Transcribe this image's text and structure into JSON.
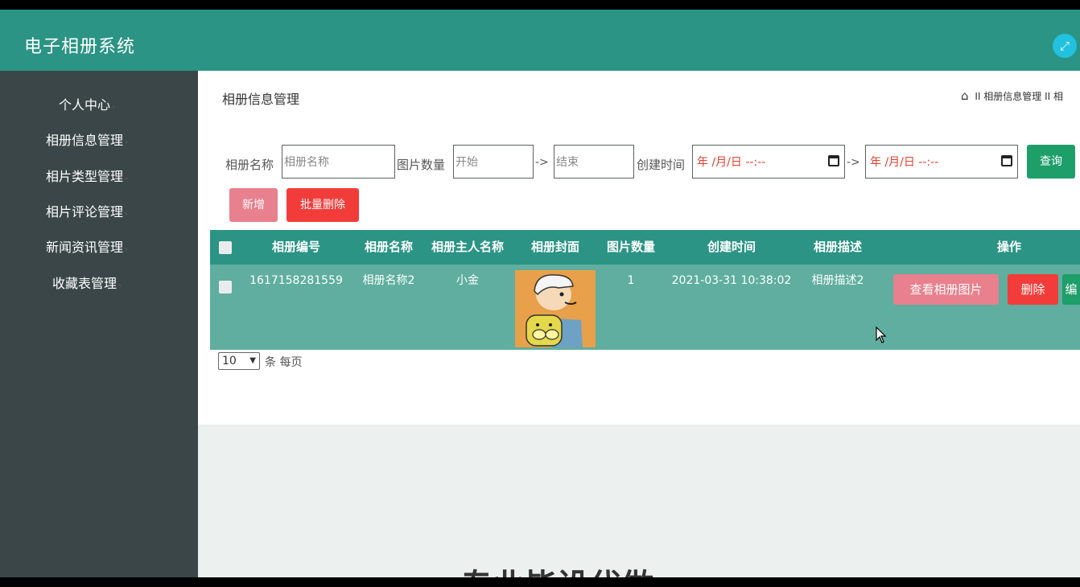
{
  "app": {
    "title": "电子相册系统",
    "fullscreen_icon": "expand-icon"
  },
  "sidebar": {
    "items": [
      {
        "label": "个人中心"
      },
      {
        "label": "相册信息管理"
      },
      {
        "label": "相片类型管理"
      },
      {
        "label": "相片评论管理"
      },
      {
        "label": "新闻资讯管理"
      },
      {
        "label": "收藏表管理"
      }
    ]
  },
  "page": {
    "title": "相册信息管理",
    "breadcrumb": {
      "sep": "II",
      "item1": "相册信息管理",
      "item2": "相"
    }
  },
  "search": {
    "name_label": "相册名称",
    "name_placeholder": "相册名称",
    "count_label": "图片数量",
    "count_start_placeholder": "开始",
    "arrow": "->",
    "count_end_placeholder": "结束",
    "time_label": "创建时间",
    "date_placeholder": "年 /月/日 --:--",
    "query_label": "查询"
  },
  "actions": {
    "add_label": "新增",
    "batch_delete_label": "批量删除"
  },
  "table": {
    "columns": [
      "相册编号",
      "相册名称",
      "相册主人名称",
      "相册封面",
      "图片数量",
      "创建时间",
      "相册描述",
      "操作"
    ],
    "rows": [
      {
        "id": "1617158281559",
        "name": "相册名称2",
        "owner": "小金",
        "count": "1",
        "created": "2021-03-31 10:38:02",
        "desc": "相册描述2",
        "view_label": "查看相册图片",
        "delete_label": "删除",
        "edit_label": "编"
      }
    ]
  },
  "pager": {
    "page_size": "10",
    "suffix": "条 每页"
  },
  "footer": {
    "text": "专业毕设代做"
  },
  "colors": {
    "header": "#2b9484",
    "sidebar": "#3a4648",
    "row": "#5fae9f",
    "query": "#1e9e69",
    "add": "#e8808d",
    "danger": "#f23c39",
    "view": "#e8808d"
  }
}
